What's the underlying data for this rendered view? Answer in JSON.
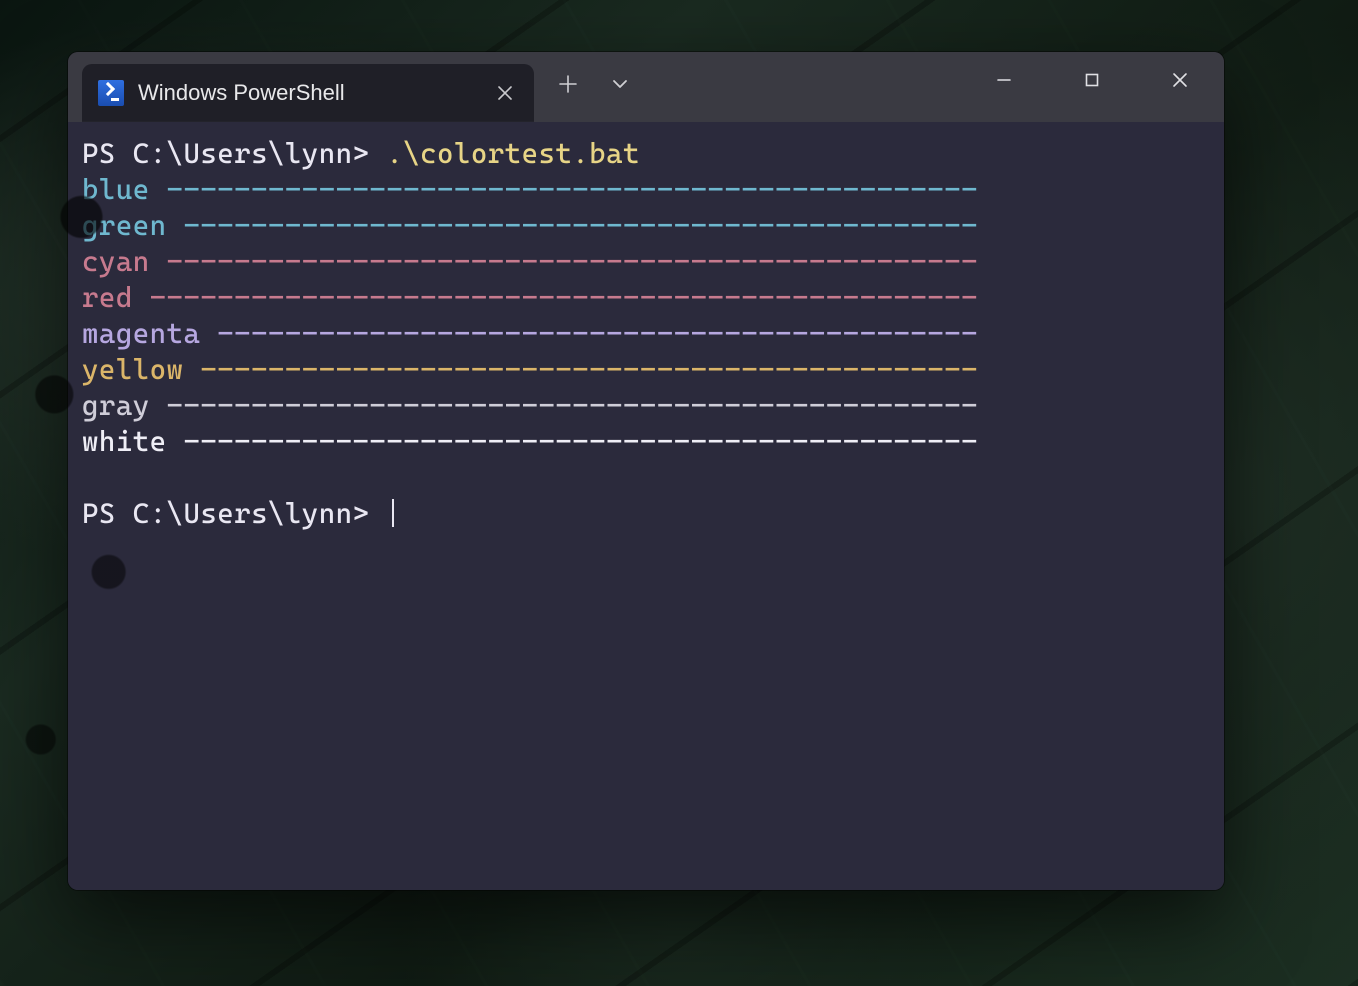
{
  "window": {
    "tab_title": "Windows PowerShell"
  },
  "terminal": {
    "prompt": "PS C:\\Users\\lynn>",
    "command": ".\\colortest.bat",
    "line_width_chars": 53,
    "lines": [
      {
        "label": "blue",
        "color": "#6fb8cf"
      },
      {
        "label": "green",
        "color": "#6fb8cf"
      },
      {
        "label": "cyan",
        "color": "#c77a8e"
      },
      {
        "label": "red",
        "color": "#c77a8e"
      },
      {
        "label": "magenta",
        "color": "#b6a7e0"
      },
      {
        "label": "yellow",
        "color": "#dbb569"
      },
      {
        "label": "gray",
        "color": "#cfcdd8"
      },
      {
        "label": "white",
        "color": "#efeef6"
      }
    ],
    "prompt2": "PS C:\\Users\\lynn>"
  }
}
